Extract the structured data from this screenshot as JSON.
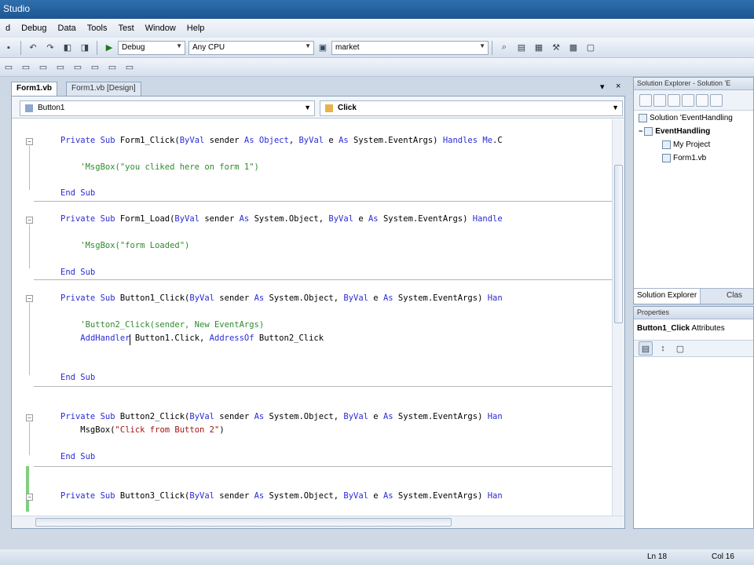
{
  "window": {
    "title": "Studio"
  },
  "menu": [
    "d",
    "Debug",
    "Data",
    "Tools",
    "Test",
    "Window",
    "Help"
  ],
  "toolbar": {
    "config": "Debug",
    "platform": "Any CPU",
    "find_text": "market"
  },
  "tabs": [
    {
      "label": "Form1.vb"
    },
    {
      "label": "Form1.vb [Design]"
    }
  ],
  "tabs_close": "×",
  "tabs_pin": "▾",
  "editor": {
    "object_combo": "Button1",
    "event_combo": "Click",
    "lines": [
      [
        {
          "t": "Private Sub",
          "c": "kw"
        },
        {
          "t": " Form1_Click(",
          "c": ""
        },
        {
          "t": "ByVal",
          "c": "kw"
        },
        {
          "t": " sender ",
          "c": ""
        },
        {
          "t": "As Object",
          "c": "kw"
        },
        {
          "t": ", ",
          "c": ""
        },
        {
          "t": "ByVal",
          "c": "kw"
        },
        {
          "t": " e ",
          "c": ""
        },
        {
          "t": "As",
          "c": "kw"
        },
        {
          "t": " System.EventArgs) ",
          "c": ""
        },
        {
          "t": "Handles Me",
          "c": "kw"
        },
        {
          "t": ".C",
          "c": ""
        }
      ],
      [
        {
          "t": "    'MsgBox(\"you cliked here on form 1\")",
          "c": "cm"
        }
      ],
      [
        {
          "t": "End Sub",
          "c": "kw"
        }
      ],
      [
        {
          "t": "Private Sub",
          "c": "kw"
        },
        {
          "t": " Form1_Load(",
          "c": ""
        },
        {
          "t": "ByVal",
          "c": "kw"
        },
        {
          "t": " sender ",
          "c": ""
        },
        {
          "t": "As",
          "c": "kw"
        },
        {
          "t": " System.Object, ",
          "c": ""
        },
        {
          "t": "ByVal",
          "c": "kw"
        },
        {
          "t": " e ",
          "c": ""
        },
        {
          "t": "As",
          "c": "kw"
        },
        {
          "t": " System.EventArgs) ",
          "c": ""
        },
        {
          "t": "Handle",
          "c": "kw"
        }
      ],
      [
        {
          "t": "    'MsgBox(\"form Loaded\")",
          "c": "cm"
        }
      ],
      [
        {
          "t": "End Sub",
          "c": "kw"
        }
      ],
      [
        {
          "t": "Private Sub",
          "c": "kw"
        },
        {
          "t": " Button1_Click(",
          "c": ""
        },
        {
          "t": "ByVal",
          "c": "kw"
        },
        {
          "t": " sender ",
          "c": ""
        },
        {
          "t": "As",
          "c": "kw"
        },
        {
          "t": " System.Object, ",
          "c": ""
        },
        {
          "t": "ByVal",
          "c": "kw"
        },
        {
          "t": " e ",
          "c": ""
        },
        {
          "t": "As",
          "c": "kw"
        },
        {
          "t": " System.EventArgs) ",
          "c": ""
        },
        {
          "t": "Han",
          "c": "kw"
        }
      ],
      [
        {
          "t": "    'Button2_Click(sender, New EventArgs)",
          "c": "cm"
        }
      ],
      [
        {
          "t": "    ",
          "c": ""
        },
        {
          "t": "AddHandler",
          "c": "kw"
        },
        {
          "t": " Button1.Click, ",
          "c": ""
        },
        {
          "t": "AddressOf",
          "c": "kw"
        },
        {
          "t": " Button2_Click",
          "c": ""
        }
      ],
      [
        {
          "t": "End Sub",
          "c": "kw"
        }
      ],
      [
        {
          "t": "Private Sub",
          "c": "kw"
        },
        {
          "t": " Button2_Click(",
          "c": ""
        },
        {
          "t": "ByVal",
          "c": "kw"
        },
        {
          "t": " sender ",
          "c": ""
        },
        {
          "t": "As",
          "c": "kw"
        },
        {
          "t": " System.Object, ",
          "c": ""
        },
        {
          "t": "ByVal",
          "c": "kw"
        },
        {
          "t": " e ",
          "c": ""
        },
        {
          "t": "As",
          "c": "kw"
        },
        {
          "t": " System.EventArgs) ",
          "c": ""
        },
        {
          "t": "Han",
          "c": "kw"
        }
      ],
      [
        {
          "t": "    MsgBox(",
          "c": ""
        },
        {
          "t": "\"Click from Button 2\"",
          "c": "st"
        },
        {
          "t": ")",
          "c": ""
        }
      ],
      [
        {
          "t": "End Sub",
          "c": "kw"
        }
      ],
      [
        {
          "t": "Private Sub",
          "c": "kw"
        },
        {
          "t": " Button3_Click(",
          "c": ""
        },
        {
          "t": "ByVal",
          "c": "kw"
        },
        {
          "t": " sender ",
          "c": ""
        },
        {
          "t": "As",
          "c": "kw"
        },
        {
          "t": " System.Object, ",
          "c": ""
        },
        {
          "t": "ByVal",
          "c": "kw"
        },
        {
          "t": " e ",
          "c": ""
        },
        {
          "t": "As",
          "c": "kw"
        },
        {
          "t": " System.EventArgs) ",
          "c": ""
        },
        {
          "t": "Han",
          "c": "kw"
        }
      ]
    ]
  },
  "solution_explorer": {
    "title": "Solution Explorer - Solution 'E",
    "items": [
      {
        "label": "Solution 'EventHandling"
      },
      {
        "label": "EventHandling"
      },
      {
        "label": "My Project"
      },
      {
        "label": "Form1.vb"
      }
    ],
    "tab_active": "Solution Explorer",
    "tab_other": "Clas"
  },
  "properties": {
    "title": "Properties",
    "object": "Button1_Click",
    "object_suffix": "Attributes"
  },
  "status": {
    "line": "Ln 18",
    "col": "Col 16"
  }
}
